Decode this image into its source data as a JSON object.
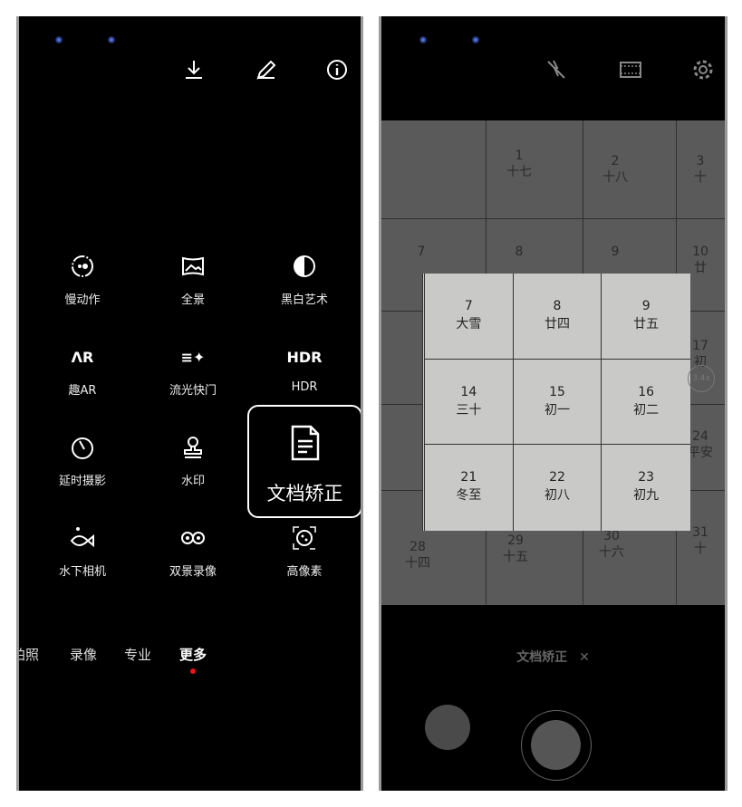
{
  "left": {
    "toolbar": [
      "download-icon",
      "edit-icon",
      "info-icon"
    ],
    "modes": [
      {
        "label": "慢动作",
        "icon": "slow-motion-icon"
      },
      {
        "label": "全景",
        "icon": "panorama-icon"
      },
      {
        "label": "黑白艺术",
        "icon": "monochrome-icon"
      },
      {
        "label": "趣AR",
        "icon": "ar-icon",
        "glyph": "ΛR"
      },
      {
        "label": "流光快门",
        "icon": "light-painting-icon",
        "glyph": "≡✦"
      },
      {
        "label": "HDR",
        "icon": "hdr-icon",
        "glyph": "HDR"
      },
      {
        "label": "延时摄影",
        "icon": "timelapse-icon"
      },
      {
        "label": "水印",
        "icon": "watermark-icon"
      },
      {
        "label": "文档矫正",
        "icon": "document-icon",
        "highlighted": true
      },
      {
        "label": "水下相机",
        "icon": "underwater-icon"
      },
      {
        "label": "双景录像",
        "icon": "dual-view-icon"
      },
      {
        "label": "高像素",
        "icon": "high-res-icon"
      }
    ],
    "tabs": [
      "拍照",
      "录像",
      "专业",
      "更多"
    ],
    "tab_visible_first": "拍照",
    "active_tab": "更多",
    "active_dot_color": "#e8141b"
  },
  "right": {
    "toolbar": [
      "flash-off-icon",
      "video-format-icon",
      "settings-icon"
    ],
    "background_dates": [
      {
        "n": "1",
        "l": "十七"
      },
      {
        "n": "2",
        "l": "十八"
      },
      {
        "n": "3",
        "l": "十"
      },
      {
        "n": "7",
        "l": ""
      },
      {
        "n": "8",
        "l": ""
      },
      {
        "n": "9",
        "l": ""
      },
      {
        "n": "10",
        "l": "廿"
      },
      {
        "n": "17",
        "l": "初"
      },
      {
        "n": "24",
        "l": "平安"
      },
      {
        "n": "28",
        "l": "十四"
      },
      {
        "n": "29",
        "l": "十五"
      },
      {
        "n": "30",
        "l": "十六"
      },
      {
        "n": "31",
        "l": "十"
      }
    ],
    "document_cells": [
      {
        "n": "7",
        "l": "大雪"
      },
      {
        "n": "8",
        "l": "廿四"
      },
      {
        "n": "9",
        "l": "廿五"
      },
      {
        "n": "14",
        "l": "三十"
      },
      {
        "n": "15",
        "l": "初一"
      },
      {
        "n": "16",
        "l": "初二"
      },
      {
        "n": "21",
        "l": "冬至"
      },
      {
        "n": "22",
        "l": "初八"
      },
      {
        "n": "23",
        "l": "初九"
      }
    ],
    "zoom_level": "3.4x",
    "mode_label": "文档矫正",
    "close_glyph": "✕"
  }
}
